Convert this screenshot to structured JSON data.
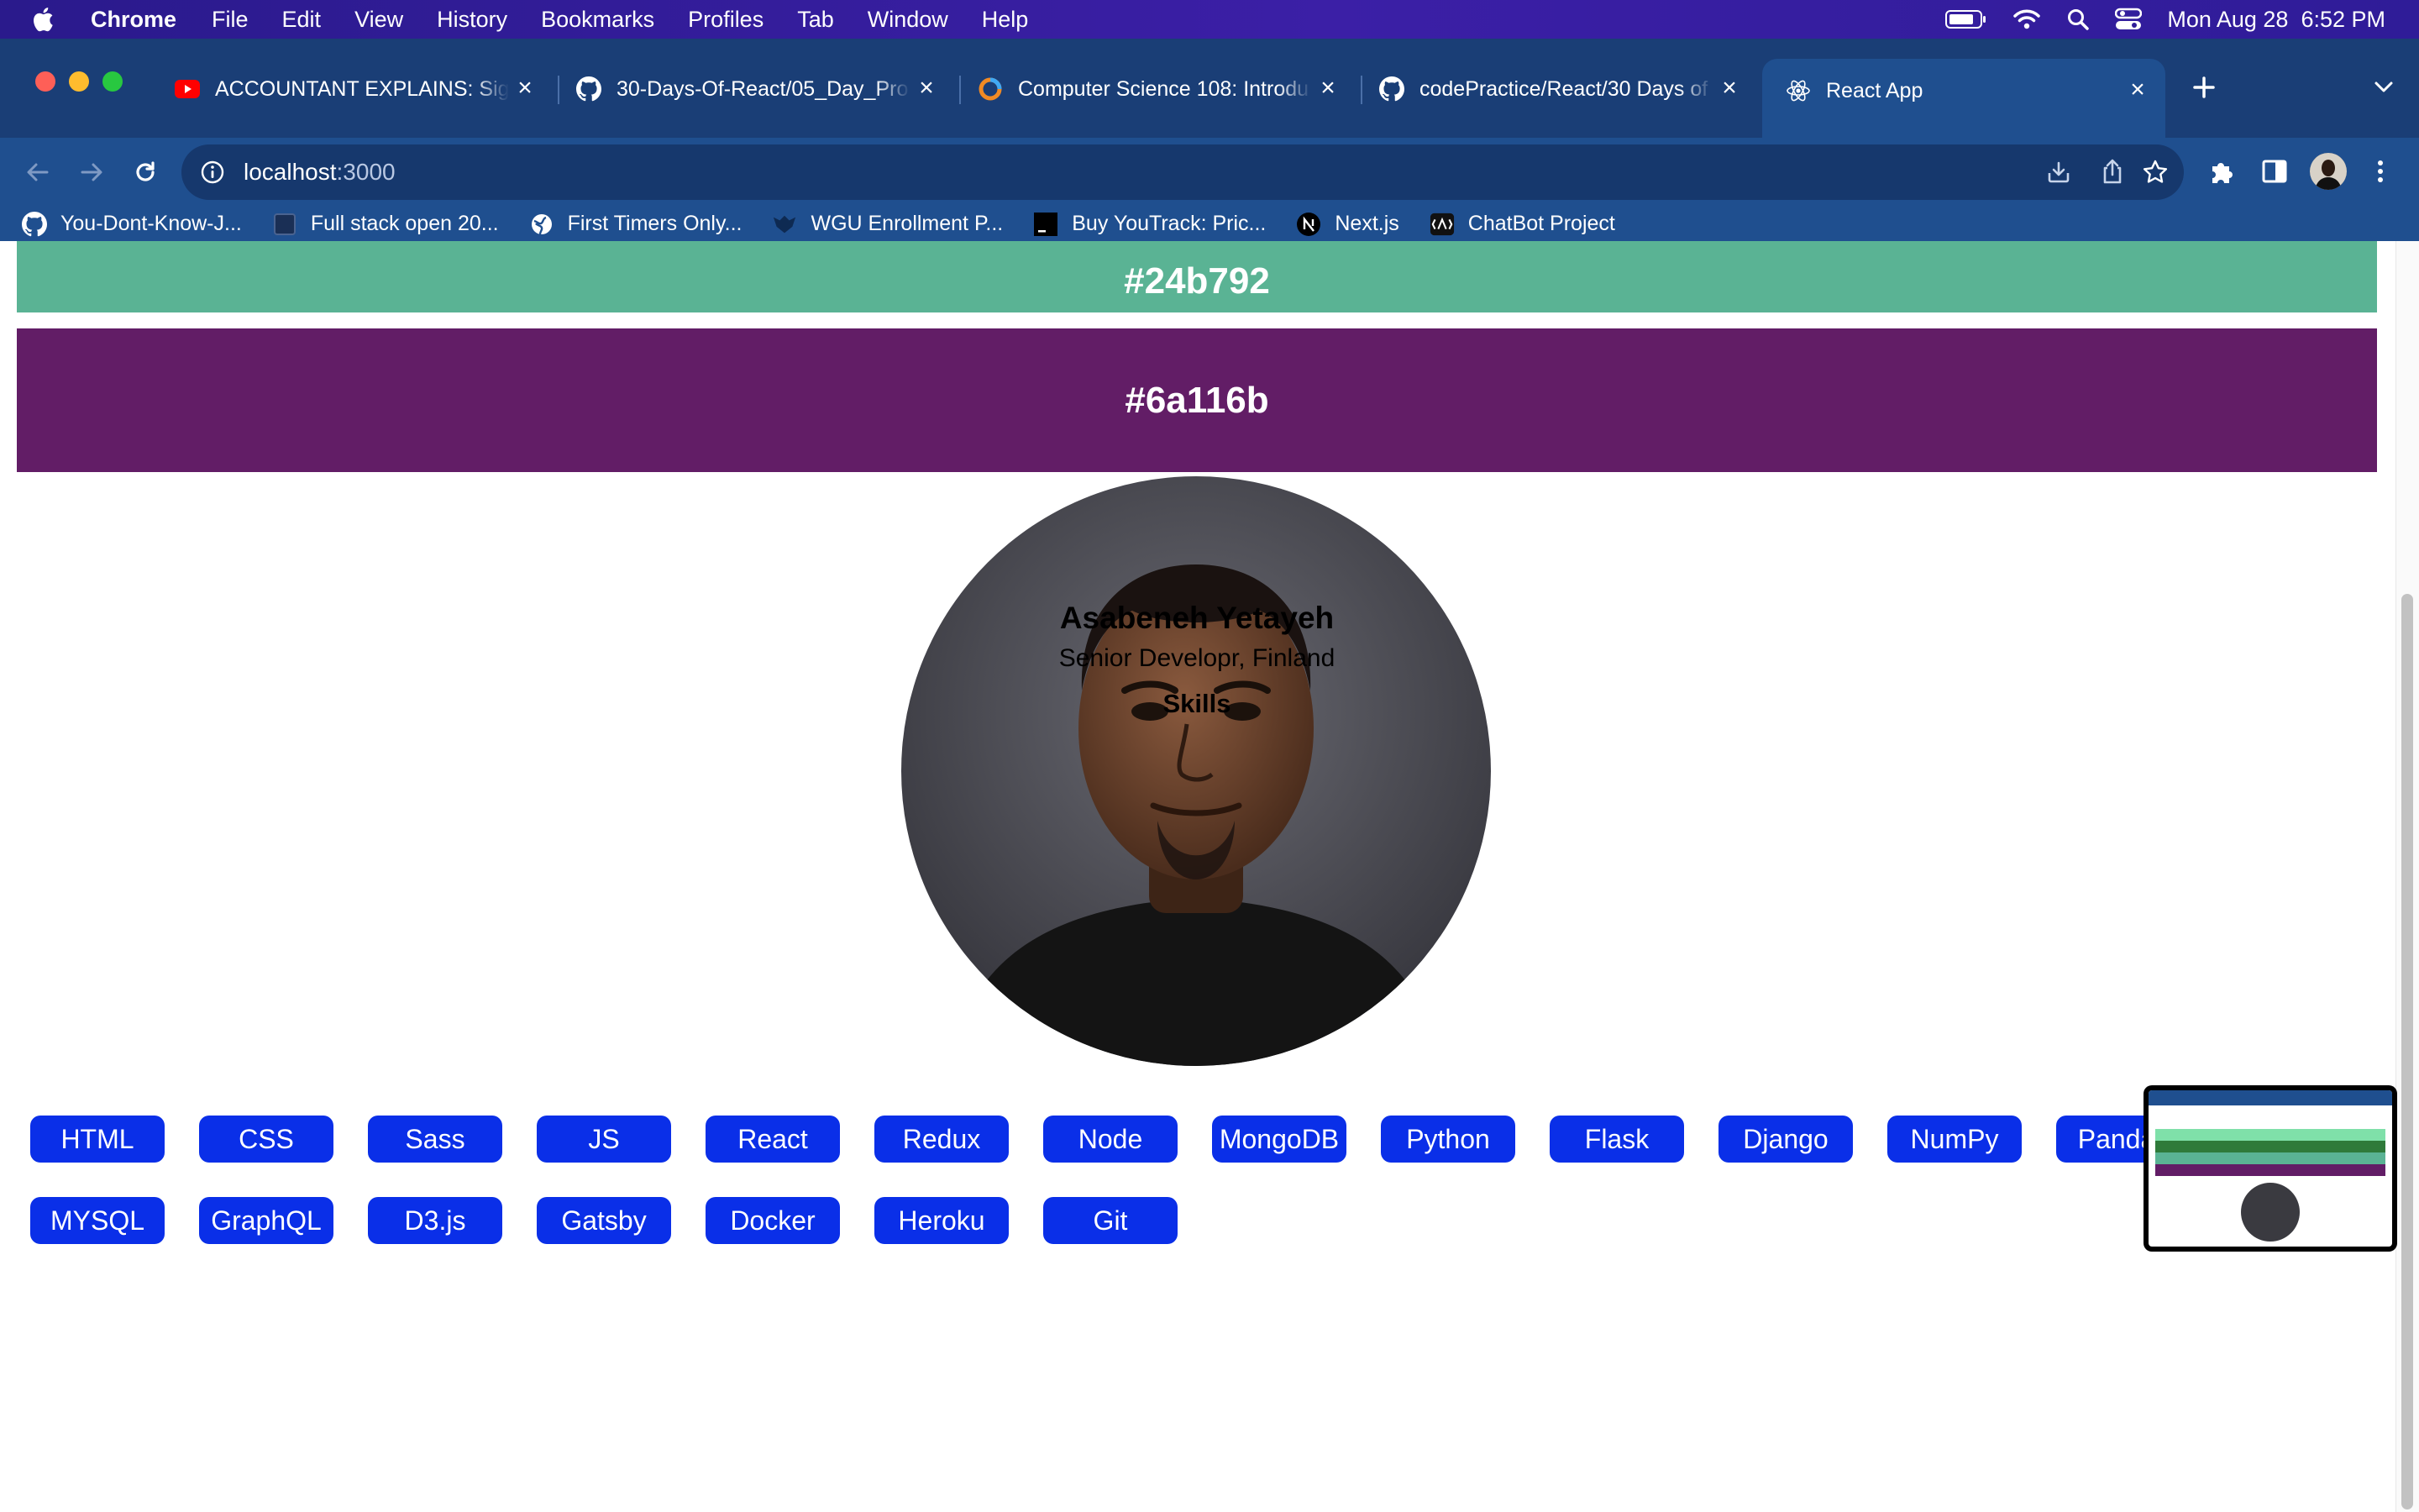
{
  "menubar": {
    "app_name": "Chrome",
    "menus": [
      "File",
      "Edit",
      "View",
      "History",
      "Bookmarks",
      "Profiles",
      "Tab",
      "Window",
      "Help"
    ],
    "clock": "Mon Aug 28  6:52 PM"
  },
  "browser": {
    "tabs": [
      {
        "title": "ACCOUNTANT EXPLAINS: Sign",
        "icon": "youtube-icon"
      },
      {
        "title": "30-Days-Of-React/05_Day_Pro",
        "icon": "github-icon"
      },
      {
        "title": "Computer Science 108: Introdu",
        "icon": "study-icon"
      },
      {
        "title": "codePractice/React/30 Days of",
        "icon": "github-icon"
      },
      {
        "title": "React App",
        "icon": "react-icon",
        "active": true
      }
    ],
    "url_host": "localhost",
    "url_port": ":3000",
    "bookmarks": [
      {
        "label": "You-Dont-Know-J...",
        "icon": "github-icon"
      },
      {
        "label": "Full stack open 20...",
        "icon": "page-icon"
      },
      {
        "label": "First Timers Only...",
        "icon": "globe-icon"
      },
      {
        "label": "WGU Enrollment P...",
        "icon": "owl-icon"
      },
      {
        "label": "Buy YouTrack: Pric...",
        "icon": "terminal-icon"
      },
      {
        "label": "Next.js",
        "icon": "nextjs-icon"
      },
      {
        "label": "ChatBot Project",
        "icon": "bot-icon"
      }
    ]
  },
  "page": {
    "swatches": [
      {
        "label": "#24b792",
        "color": "#5ab394"
      },
      {
        "label": "#6a116b",
        "color": "#621d66"
      }
    ],
    "profile": {
      "name": "Asabeneh Yetayeh",
      "subtitle": "Senior Developr, Finland",
      "skills_heading": "Skills"
    },
    "skills": [
      "HTML",
      "CSS",
      "Sass",
      "JS",
      "React",
      "Redux",
      "Node",
      "MongoDB",
      "Python",
      "Flask",
      "Django",
      "NumPy",
      "Pandas",
      "MYSQL",
      "GraphQL",
      "D3.js",
      "Gatsby",
      "Docker",
      "Heroku",
      "Git"
    ],
    "colors": {
      "skill_button": "#0a2fe8"
    }
  }
}
